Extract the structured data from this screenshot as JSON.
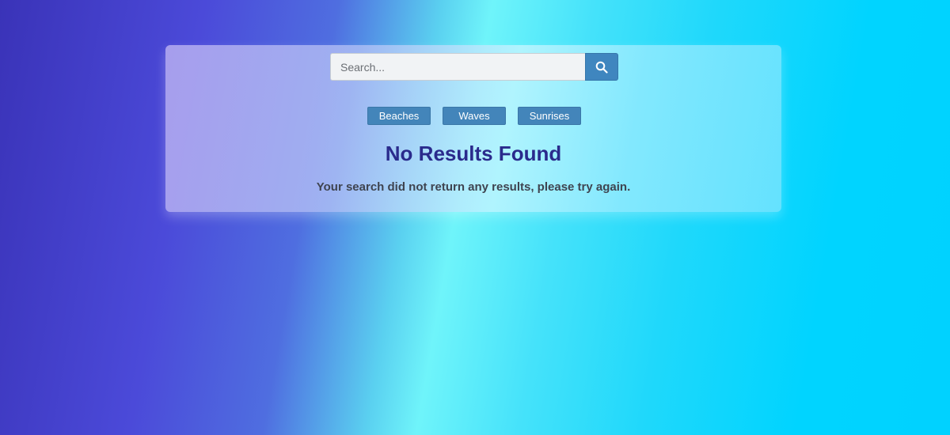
{
  "search": {
    "placeholder": "Search...",
    "value": "",
    "button_icon": "search-icon"
  },
  "tags": [
    {
      "label": "Beaches"
    },
    {
      "label": "Waves"
    },
    {
      "label": "Sunrises"
    }
  ],
  "result": {
    "title": "No Results Found",
    "message": "Your search did not return any results, please try again."
  },
  "colors": {
    "button": "#4385ba",
    "title": "#2a2a8c",
    "message": "#3f4450",
    "background_start": "#3a33b8",
    "background_end": "#00d2ff"
  }
}
